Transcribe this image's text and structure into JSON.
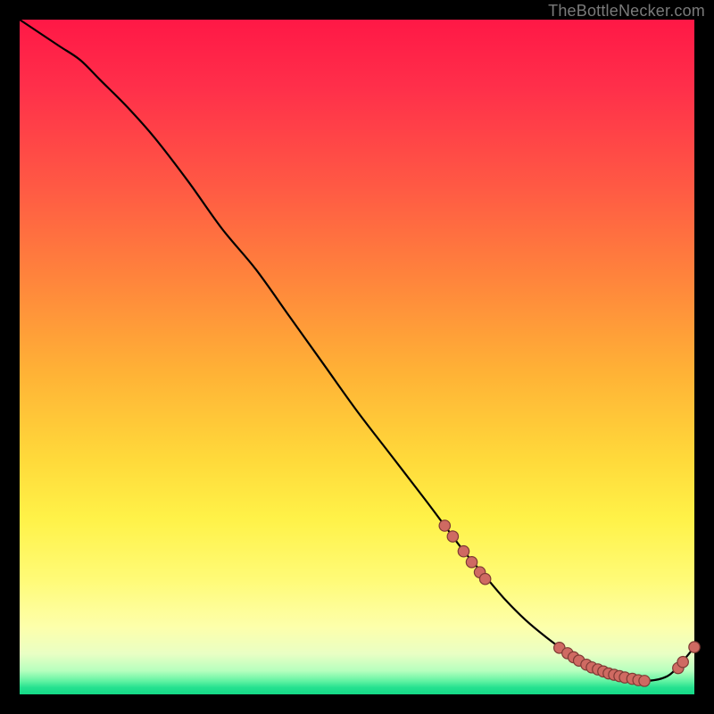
{
  "watermark": "TheBottleNecker.com",
  "colors": {
    "marker_fill": "#cf6a62",
    "marker_stroke": "#7e3a34",
    "line": "#000000"
  },
  "chart_data": {
    "type": "line",
    "title": "",
    "xlabel": "",
    "ylabel": "",
    "xlim": [
      0,
      100
    ],
    "ylim": [
      0,
      100
    ],
    "grid": false,
    "legend": false,
    "series": [
      {
        "name": "curve",
        "x": [
          0,
          3,
          6,
          9,
          12,
          16,
          20,
          25,
          30,
          35,
          40,
          45,
          50,
          55,
          60,
          63,
          66,
          69,
          72,
          75,
          78,
          81,
          84,
          87,
          90,
          93,
          96,
          98,
          100
        ],
        "y": [
          100,
          98,
          96,
          94,
          91,
          87,
          82.5,
          76,
          69,
          63,
          56,
          49,
          42,
          35.5,
          29,
          25,
          21,
          17.5,
          14,
          11,
          8.5,
          6.3,
          4.6,
          3.3,
          2.4,
          2.0,
          2.7,
          4.6,
          7
        ]
      }
    ],
    "markers": [
      {
        "x": 63.0,
        "y": 25.0
      },
      {
        "x": 64.2,
        "y": 23.4
      },
      {
        "x": 65.8,
        "y": 21.2
      },
      {
        "x": 67.0,
        "y": 19.6
      },
      {
        "x": 68.2,
        "y": 18.1
      },
      {
        "x": 69.0,
        "y": 17.1
      },
      {
        "x": 80.0,
        "y": 6.9
      },
      {
        "x": 81.2,
        "y": 6.1
      },
      {
        "x": 82.1,
        "y": 5.5
      },
      {
        "x": 82.9,
        "y": 5.0
      },
      {
        "x": 84.0,
        "y": 4.4
      },
      {
        "x": 84.8,
        "y": 4.0
      },
      {
        "x": 85.7,
        "y": 3.7
      },
      {
        "x": 86.5,
        "y": 3.4
      },
      {
        "x": 87.3,
        "y": 3.1
      },
      {
        "x": 88.1,
        "y": 2.9
      },
      {
        "x": 88.9,
        "y": 2.7
      },
      {
        "x": 89.7,
        "y": 2.5
      },
      {
        "x": 90.8,
        "y": 2.3
      },
      {
        "x": 91.7,
        "y": 2.1
      },
      {
        "x": 92.6,
        "y": 2.0
      },
      {
        "x": 97.6,
        "y": 3.9
      },
      {
        "x": 98.3,
        "y": 4.8
      },
      {
        "x": 100.0,
        "y": 7.0
      }
    ]
  }
}
